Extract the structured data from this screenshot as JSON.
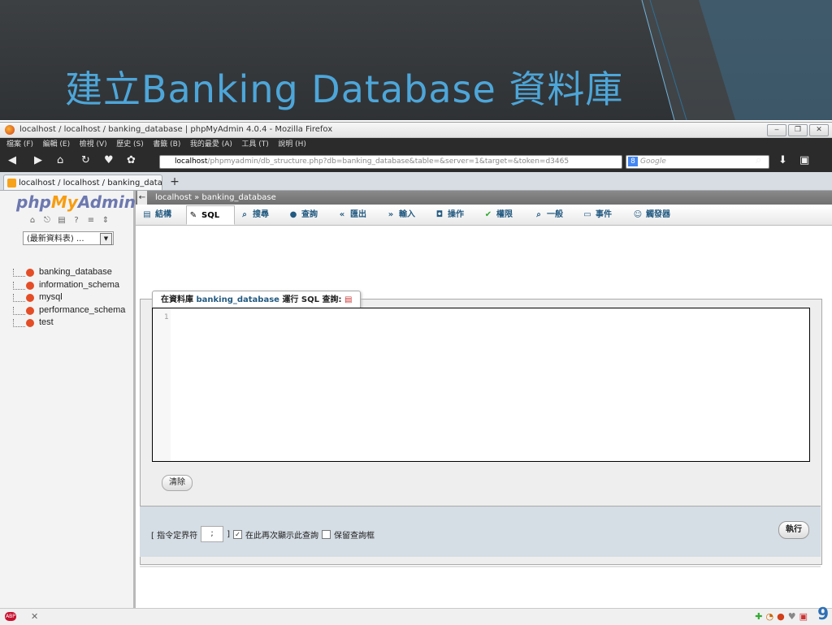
{
  "slide": {
    "title": "建立Banking Database 資料庫",
    "page_number": "9"
  },
  "browser": {
    "window_title": "localhost / localhost / banking_database | phpMyAdmin 4.0.4 - Mozilla Firefox",
    "menu": [
      "檔案 (F)",
      "編輯 (E)",
      "檢視 (V)",
      "歷史 (S)",
      "書籤 (B)",
      "我的最愛 (A)",
      "工具 (T)",
      "說明 (H)"
    ],
    "url_host": "localhost",
    "url_rest": "/phpmyadmin/db_structure.php?db=banking_database&table=&server=1&target=&token=d3465",
    "search_placeholder": "Google",
    "tab_label": "localhost / localhost / banking_datab...",
    "new_tab": "+"
  },
  "sidebar": {
    "logo_php": "php",
    "logo_my": "My",
    "logo_admin": "Admin",
    "recent_label": "(最新資料表) ...",
    "databases": [
      "banking_database",
      "information_schema",
      "mysql",
      "performance_schema",
      "test"
    ]
  },
  "main": {
    "breadcrumb": "localhost » banking_database",
    "tabs": [
      {
        "label": "結構",
        "icon": "structure-icon"
      },
      {
        "label": "SQL",
        "icon": "wrench-icon",
        "active": true
      },
      {
        "label": "搜尋",
        "icon": "search-icon"
      },
      {
        "label": "查詢",
        "icon": "query-icon"
      },
      {
        "label": "匯出",
        "icon": "export-icon"
      },
      {
        "label": "輸入",
        "icon": "import-icon"
      },
      {
        "label": "操作",
        "icon": "operations-icon"
      },
      {
        "label": "權限",
        "icon": "privileges-icon"
      },
      {
        "label": "一般",
        "icon": "routines-icon"
      },
      {
        "label": "事件",
        "icon": "events-icon"
      },
      {
        "label": "觸發器",
        "icon": "triggers-icon"
      }
    ],
    "legend_prefix": "在資料庫",
    "legend_db": "banking_database",
    "legend_suffix": "運行 SQL 查詢:",
    "editor_line": "1",
    "clear_label": "清除",
    "delimiter_label": "[ 指令定界符",
    "delimiter_value": ";",
    "delimiter_close": "]",
    "show_again_label": "在此再次顯示此查詢",
    "show_again_checked": true,
    "keep_box_label": "保留查詢框",
    "keep_box_checked": false,
    "go_label": "執行"
  }
}
